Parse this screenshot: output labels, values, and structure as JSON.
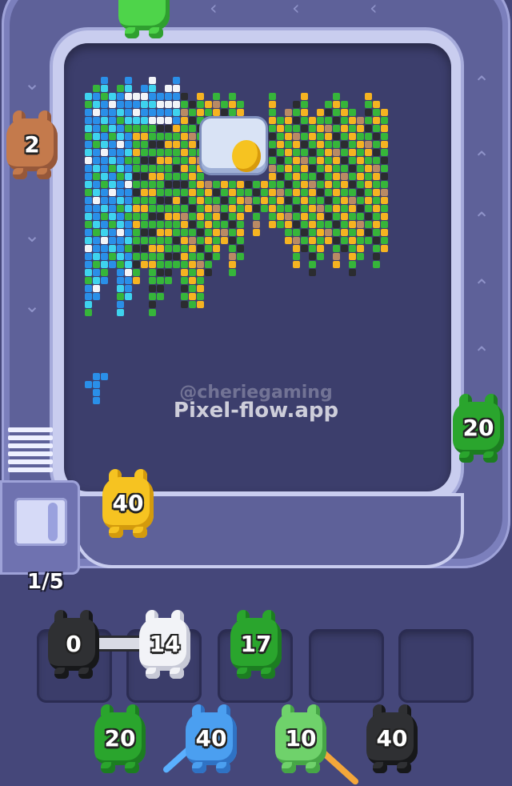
{
  "level": {
    "progress": "1/5"
  },
  "watermark": {
    "handle": "@cheriegaming",
    "site": "Pixel-flow.app"
  },
  "conveyor_shooters": [
    {
      "id": "top",
      "value": "",
      "color": "lime"
    },
    {
      "id": "left",
      "value": "2",
      "color": "brown"
    },
    {
      "id": "right",
      "value": "20",
      "color": "green"
    },
    {
      "id": "bottom",
      "value": "40",
      "color": "yellow"
    }
  ],
  "slots": [
    {
      "value": "0",
      "color": "black"
    },
    {
      "value": "14",
      "color": "white"
    },
    {
      "value": "17",
      "color": "green"
    },
    {
      "value": "",
      "color": "empty"
    },
    {
      "value": "",
      "color": "empty"
    }
  ],
  "queue": [
    {
      "value": "20",
      "color": "green"
    },
    {
      "value": "40",
      "color": "blue"
    },
    {
      "value": "10",
      "color": "lime"
    },
    {
      "value": "40",
      "color": "black"
    }
  ],
  "palette": {
    "blue": "#2a8fe8",
    "cyan": "#3ed3ee",
    "white": "#f2f4f8",
    "green": "#36b53a",
    "yellow": "#f5b321",
    "black": "#2b2c30",
    "tan": "#b98a64"
  },
  "icons": {
    "chevron": "chevron-icon",
    "bomb": "cracked-egg-icon"
  }
}
